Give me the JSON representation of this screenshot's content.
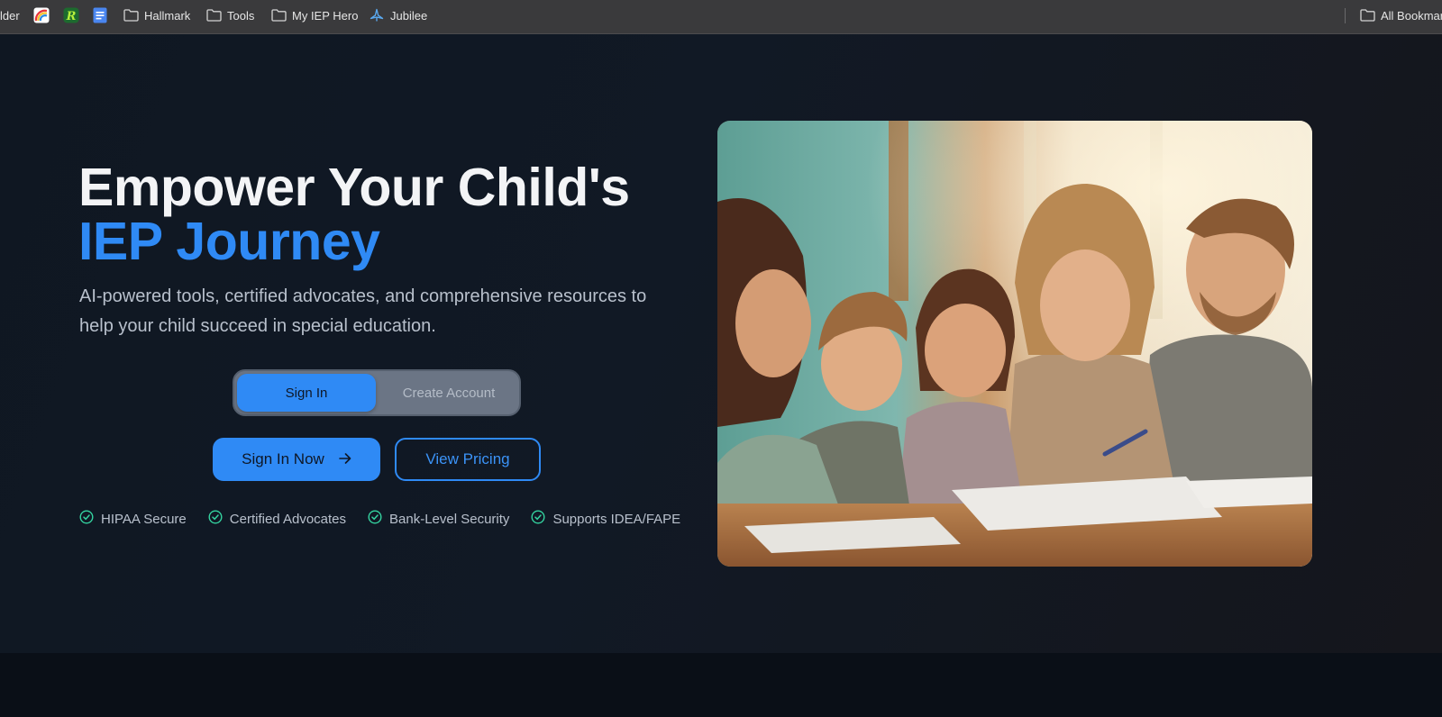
{
  "bookmarks": {
    "partial_left": "lder",
    "items": [
      {
        "label": "Hallmark",
        "icon": "folder-icon"
      },
      {
        "label": "Tools",
        "icon": "folder-icon"
      },
      {
        "label": "My IEP Hero",
        "icon": "folder-icon"
      },
      {
        "label": "Jubilee",
        "icon": "jubilee-logo-icon"
      }
    ],
    "all_bookmarks": "All Bookmar"
  },
  "hero": {
    "title_line1": "Empower Your Child's",
    "title_line2": "IEP Journey",
    "subtitle": "AI-powered tools, certified advocates, and comprehensive resources to help your child succeed in special education.",
    "auth_toggle": {
      "sign_in": "Sign In",
      "create_account": "Create Account",
      "active": "Sign In"
    },
    "primary_cta": "Sign In Now",
    "secondary_cta": "View Pricing",
    "badges": [
      "HIPAA Secure",
      "Certified Advocates",
      "Bank-Level Security",
      "Supports IDEA/FAPE"
    ]
  },
  "colors": {
    "accent": "#2f8af5",
    "badge_check": "#34d3a0",
    "background": "#0d131c"
  }
}
